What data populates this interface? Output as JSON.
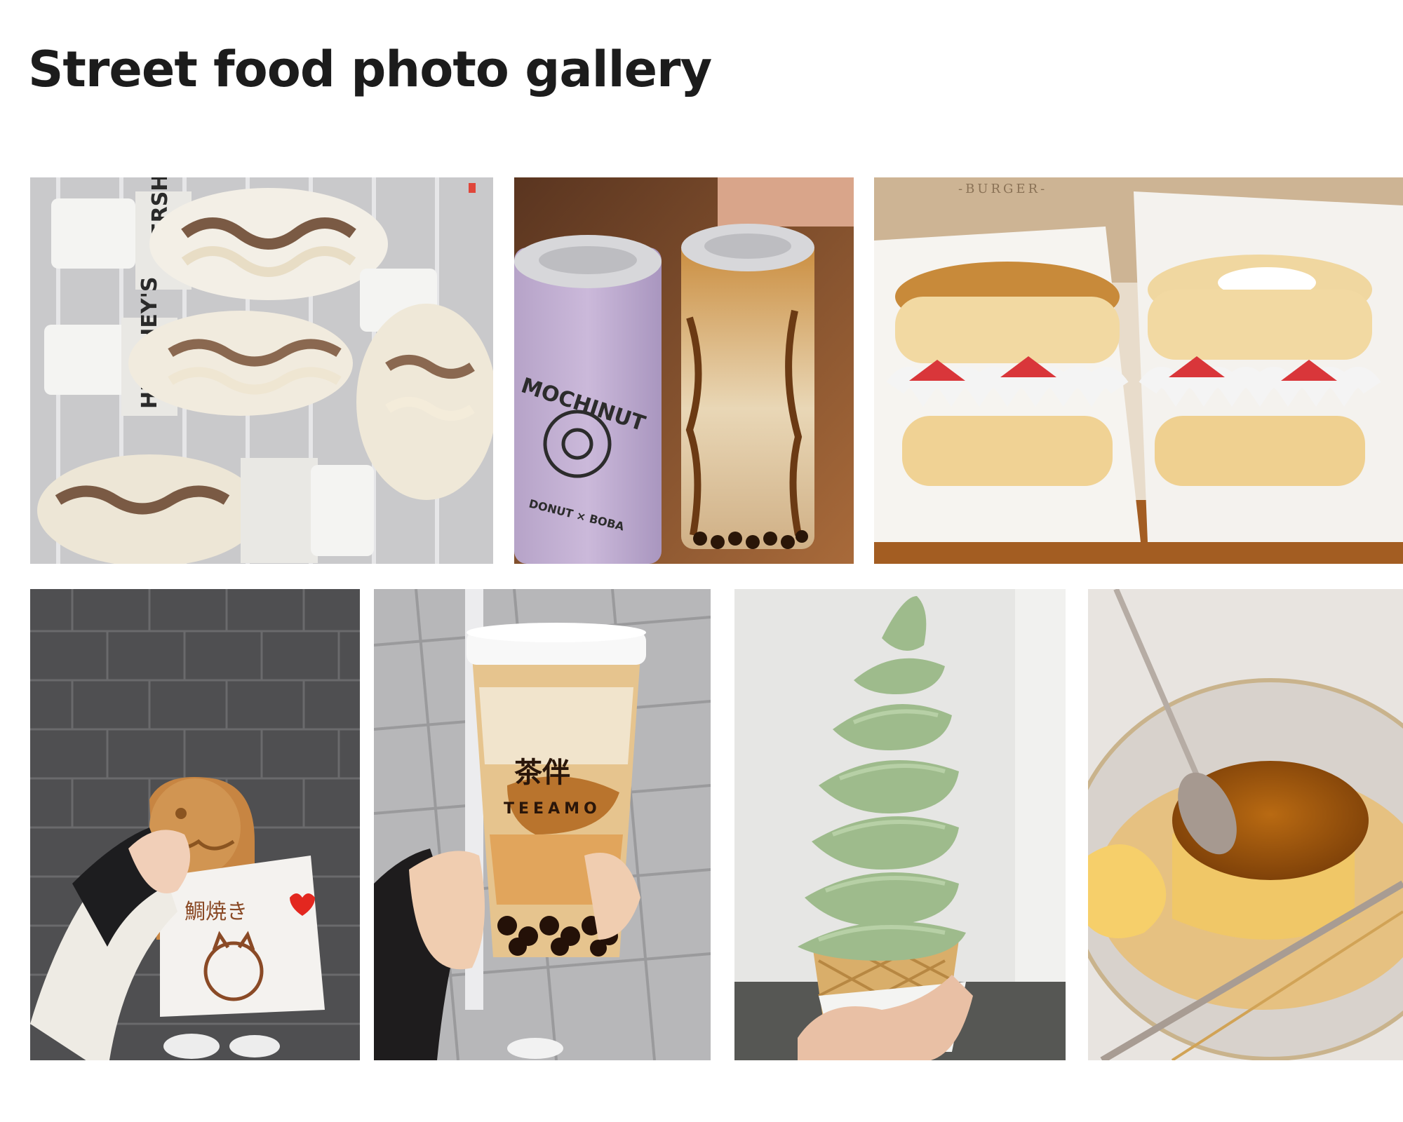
{
  "header": {
    "title": "Street food photo gallery"
  },
  "colors": {
    "background": "#ffffff",
    "title": "#1c1c1c"
  },
  "gallery": {
    "photos": [
      {
        "subject": "hersheys-soft-serve-cones",
        "texts": [
          "HERSHEY'S",
          "HERSHEY'S"
        ]
      },
      {
        "subject": "canned-bubble-tea",
        "texts": [
          "MOCHINUT",
          "DONUT × BOBA"
        ]
      },
      {
        "subject": "strawberry-pancake-burgers",
        "texts": [
          "-BURGER-"
        ]
      },
      {
        "subject": "taiyaki-in-paper-bag",
        "texts": [
          "鯛焼き"
        ]
      },
      {
        "subject": "brown-sugar-boba-cup",
        "texts": [
          "茶伴",
          "TEEAMO"
        ]
      },
      {
        "subject": "matcha-soft-serve-cone",
        "texts": []
      },
      {
        "subject": "custard-pudding-with-spoon",
        "texts": []
      }
    ]
  }
}
